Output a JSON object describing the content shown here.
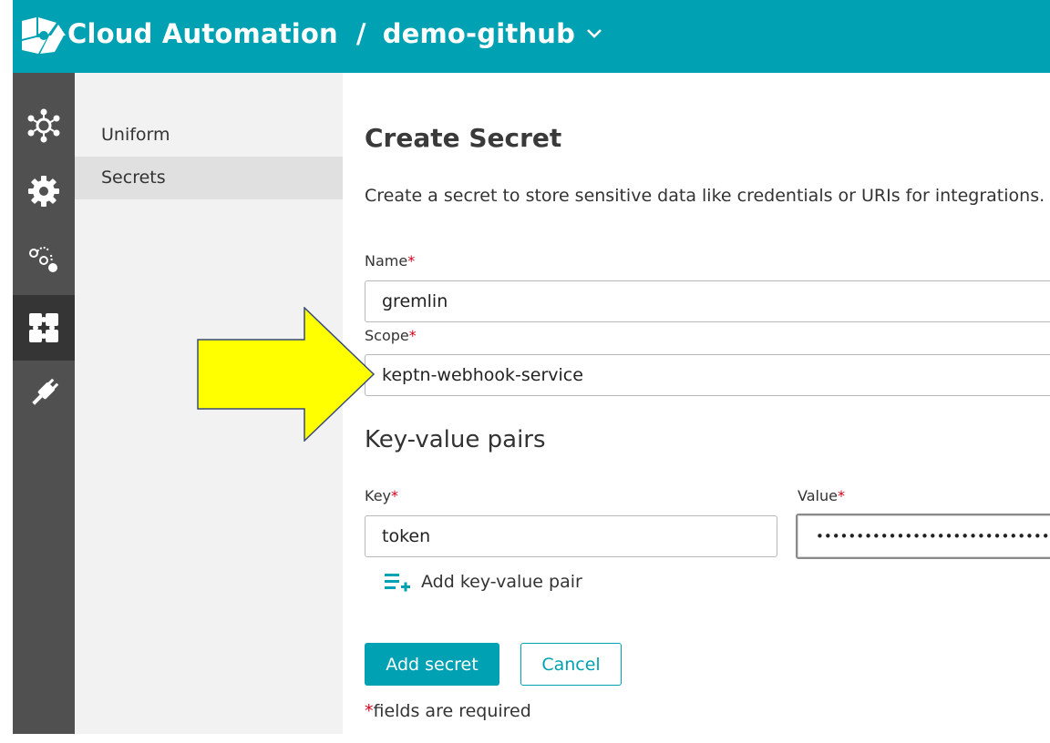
{
  "header": {
    "app_name": "Cloud Automation",
    "separator": "/",
    "project": "demo-github",
    "brand_color": "#00a1b2"
  },
  "iconbar": {
    "items": [
      {
        "icon": "services-icon",
        "active": false
      },
      {
        "icon": "settings-gear-icon",
        "active": false
      },
      {
        "icon": "sequence-icon",
        "active": false
      },
      {
        "icon": "integrations-puzzle-icon",
        "active": true
      },
      {
        "icon": "plug-icon",
        "active": false
      }
    ]
  },
  "subnav": {
    "items": [
      {
        "label": "Uniform",
        "active": false
      },
      {
        "label": "Secrets",
        "active": true
      }
    ]
  },
  "form": {
    "title": "Create Secret",
    "description": "Create a secret to store sensitive data like credentials or URIs for integrations.",
    "name_label": "Name",
    "name_value": "gremlin",
    "scope_label": "Scope",
    "scope_value": "keptn-webhook-service",
    "kv_heading": "Key-value pairs",
    "key_label": "Key",
    "key_value": "token",
    "value_label": "Value",
    "value_masked": "••••••••••••••••••••••••••••••••••••••",
    "required_mark": "*",
    "add_pair_label": "Add key-value pair",
    "submit_label": "Add secret",
    "cancel_label": "Cancel",
    "required_note": "fields are required"
  },
  "colors": {
    "required": "#d0021b",
    "sidebar_dark": "#505050",
    "arrow_fill": "#ffff00"
  }
}
